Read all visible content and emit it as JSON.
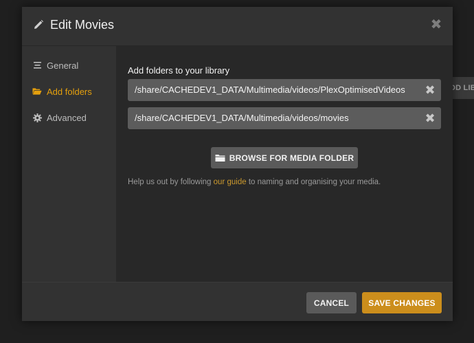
{
  "background": {
    "partial_button_label": "DD LIB"
  },
  "modal": {
    "title": "Edit Movies",
    "title_icon": "pencil-icon",
    "close_glyph": "✖"
  },
  "sidebar": {
    "items": [
      {
        "label": "General",
        "icon": "list-icon",
        "active": false
      },
      {
        "label": "Add folders",
        "icon": "folder-open-icon",
        "active": true
      },
      {
        "label": "Advanced",
        "icon": "gear-icon",
        "active": false
      }
    ]
  },
  "content": {
    "section_label": "Add folders to your library",
    "folders": [
      {
        "path": "/share/CACHEDEV1_DATA/Multimedia/videos/PlexOptimisedVideos"
      },
      {
        "path": "/share/CACHEDEV1_DATA/Multimedia/videos/movies"
      }
    ],
    "remove_glyph": "✖",
    "browse_label": "BROWSE FOR MEDIA FOLDER",
    "help_prefix": "Help us out by following ",
    "help_link": "our guide",
    "help_suffix": " to naming and organising your media."
  },
  "footer": {
    "cancel_label": "CANCEL",
    "save_label": "SAVE CHANGES"
  },
  "colors": {
    "accent": "#e5a00d",
    "save_button": "#cc8e1c",
    "link": "#cc9a2e"
  }
}
